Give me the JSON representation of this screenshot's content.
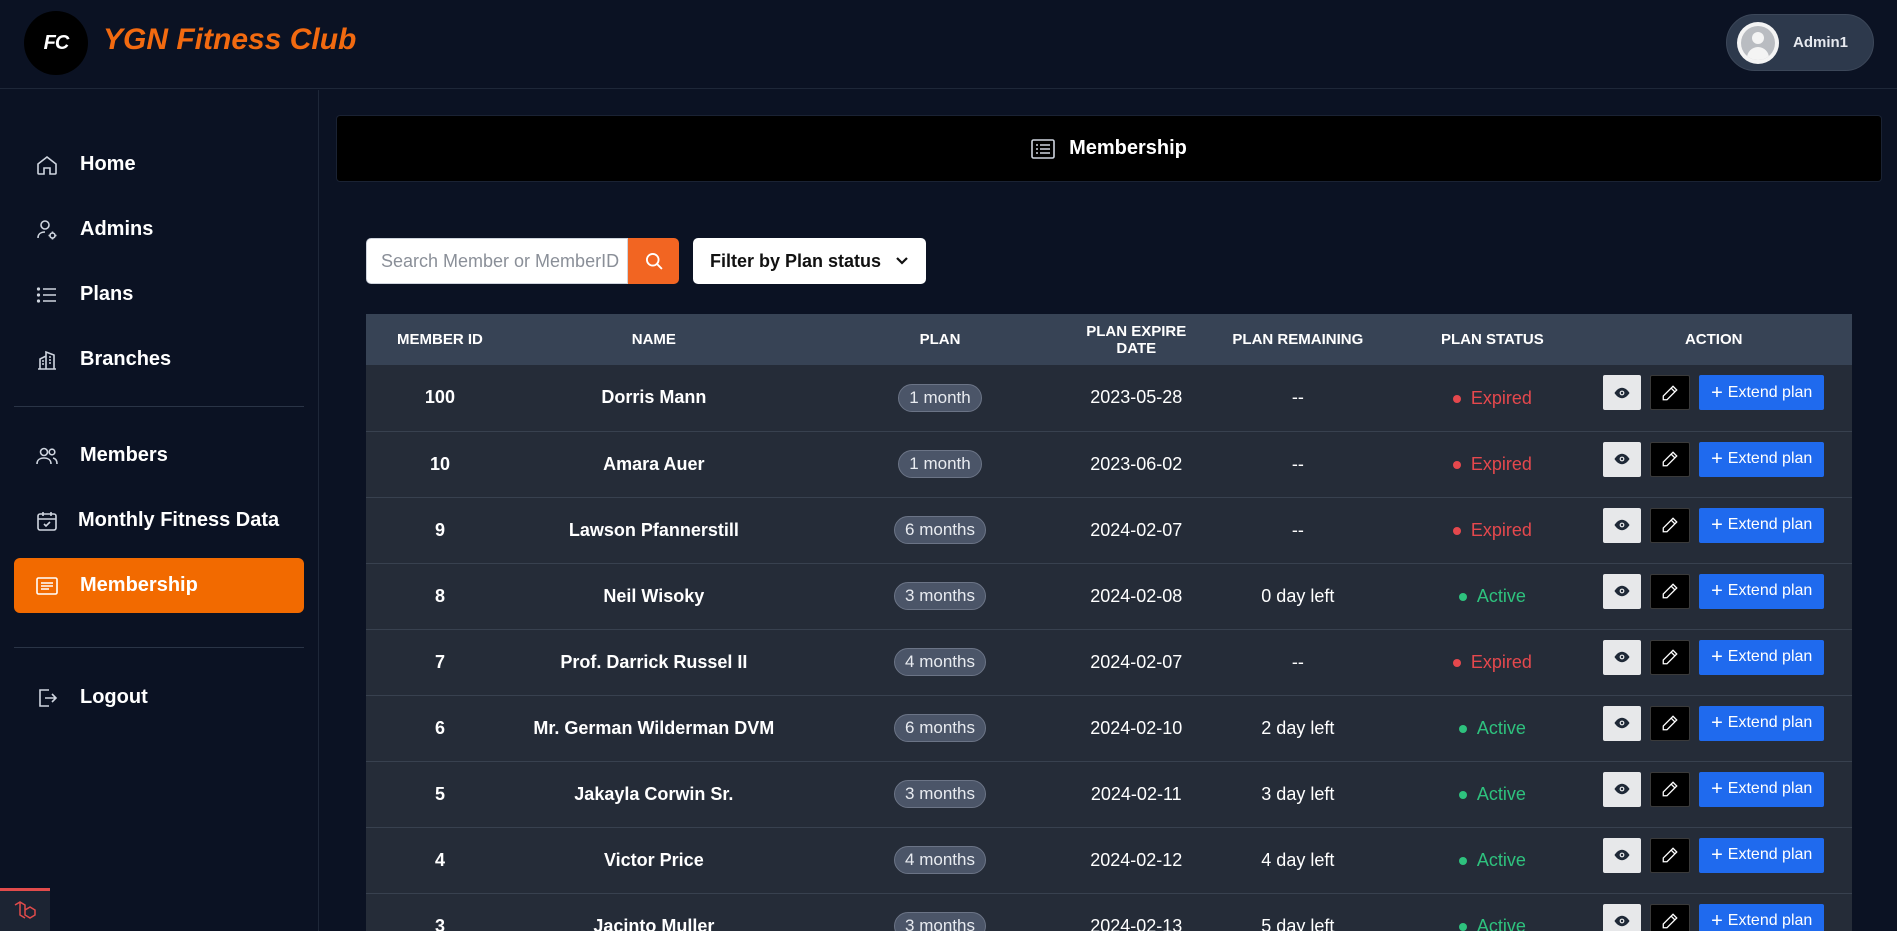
{
  "app": {
    "logo_text": "FC",
    "brand": "YGN Fitness Club",
    "user": "Admin1",
    "accent": "#f26a00"
  },
  "sidebar": {
    "items": [
      {
        "label": "Home",
        "icon": "home-icon"
      },
      {
        "label": "Admins",
        "icon": "admin-gear-icon"
      },
      {
        "label": "Plans",
        "icon": "list-icon"
      },
      {
        "label": "Branches",
        "icon": "buildings-icon"
      },
      {
        "label": "Members",
        "icon": "users-icon"
      },
      {
        "label": "Monthly Fitness Data",
        "icon": "calendar-check-icon"
      },
      {
        "label": "Membership",
        "icon": "card-list-icon",
        "active": true
      },
      {
        "label": "Logout",
        "icon": "logout-icon"
      }
    ]
  },
  "page": {
    "title": "Membership"
  },
  "search": {
    "placeholder": "Search Member or MemberID",
    "value": ""
  },
  "filter": {
    "label": "Filter by Plan status"
  },
  "table": {
    "columns": [
      "MEMBER ID",
      "NAME",
      "PLAN",
      "PLAN EXPIRE DATE",
      "PLAN REMAINING",
      "PLAN STATUS",
      "ACTION"
    ],
    "extend_label": "Extend plan",
    "rows": [
      {
        "id": "100",
        "name": "Dorris Mann",
        "plan": "1 month",
        "expire": "2023-05-28",
        "remaining": "--",
        "status": "Expired"
      },
      {
        "id": "10",
        "name": "Amara Auer",
        "plan": "1 month",
        "expire": "2023-06-02",
        "remaining": "--",
        "status": "Expired"
      },
      {
        "id": "9",
        "name": "Lawson Pfannerstill",
        "plan": "6 months",
        "expire": "2024-02-07",
        "remaining": "--",
        "status": "Expired"
      },
      {
        "id": "8",
        "name": "Neil Wisoky",
        "plan": "3 months",
        "expire": "2024-02-08",
        "remaining": "0 day left",
        "status": "Active"
      },
      {
        "id": "7",
        "name": "Prof. Darrick Russel II",
        "plan": "4 months",
        "expire": "2024-02-07",
        "remaining": "--",
        "status": "Expired"
      },
      {
        "id": "6",
        "name": "Mr. German Wilderman DVM",
        "plan": "6 months",
        "expire": "2024-02-10",
        "remaining": "2 day left",
        "status": "Active"
      },
      {
        "id": "5",
        "name": "Jakayla Corwin Sr.",
        "plan": "3 months",
        "expire": "2024-02-11",
        "remaining": "3 day left",
        "status": "Active"
      },
      {
        "id": "4",
        "name": "Victor Price",
        "plan": "4 months",
        "expire": "2024-02-12",
        "remaining": "4 day left",
        "status": "Active"
      },
      {
        "id": "3",
        "name": "Jacinto Muller",
        "plan": "3 months",
        "expire": "2024-02-13",
        "remaining": "5 day left",
        "status": "Active"
      }
    ]
  }
}
